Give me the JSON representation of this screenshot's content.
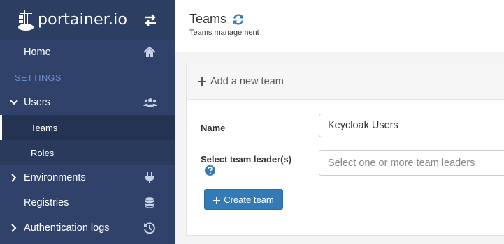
{
  "sidebar": {
    "brand": "portainer.io",
    "items": [
      {
        "label": "Home",
        "icon": "home-icon"
      },
      {
        "label": "SETTINGS"
      },
      {
        "label": "Users",
        "icon": "users-icon"
      },
      {
        "label": "Teams"
      },
      {
        "label": "Roles"
      },
      {
        "label": "Environments",
        "icon": "plug-icon"
      },
      {
        "label": "Registries",
        "icon": "database-icon"
      },
      {
        "label": "Authentication logs",
        "icon": "history-icon"
      }
    ]
  },
  "header": {
    "title": "Teams",
    "subtitle": "Teams management"
  },
  "panel": {
    "title": "Add a new team",
    "name_label": "Name",
    "name_value": "Keycloak Users",
    "leader_label": "Select team leader(s)",
    "leader_placeholder": "Select one or more team leaders",
    "create_button": "Create team"
  },
  "colors": {
    "sidebar": "#30426a",
    "accent": "#337ab7",
    "section": "#6b8ac8"
  }
}
